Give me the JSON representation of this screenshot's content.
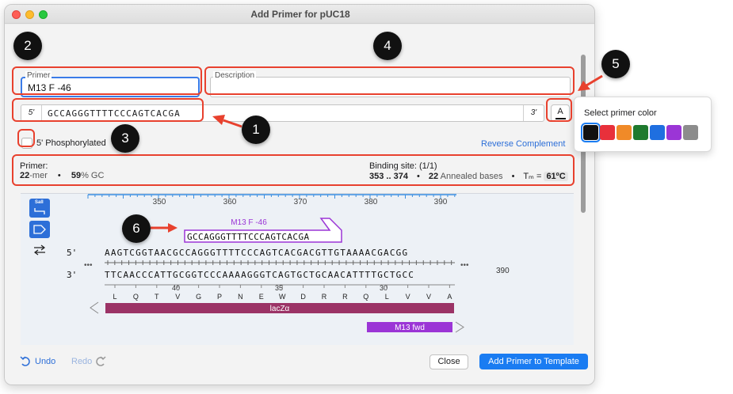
{
  "window": {
    "title": "Add Primer for pUC18"
  },
  "primer_name": {
    "legend": "Primer",
    "value": "M13 F -46"
  },
  "description": {
    "legend": "Description",
    "value": ""
  },
  "sequence_entry": {
    "prime5": "5'",
    "prime3": "3'",
    "value": "GCCAGGGTTTTCCCAGTCACGA"
  },
  "color_button": {
    "glyph": "A"
  },
  "phosphorylated": {
    "label": "5' Phosphorylated",
    "checked": false
  },
  "reverse_complement": {
    "label": "Reverse Complement"
  },
  "stats": {
    "primer_label": "Primer:",
    "length": "22",
    "length_unit": "-mer",
    "bullet": "•",
    "gc": "59",
    "gc_unit": "% GC",
    "binding_label": "Binding site: (1/1)",
    "range": "353 .. 374",
    "annealed": "22",
    "annealed_unit": "Annealed bases",
    "tm_label": "Tₘ =",
    "tm_value": "61ºC"
  },
  "color_popover": {
    "title": "Select primer color",
    "colors": [
      "#111111",
      "#e8303b",
      "#f08a28",
      "#1f7a2e",
      "#1f6fe0",
      "#9b35d6",
      "#8c8c8c"
    ],
    "selected_index": 0
  },
  "sequence_view": {
    "ruler": [
      "350",
      "360",
      "370",
      "380",
      "390"
    ],
    "primer_label": "M13 F -46",
    "primer_seq": "GCCAGGGTTTTCCCAGTCACGA",
    "top_prime": "5'",
    "top_seq": "AAGTCGGTAACGCCAGGGTTTTCCCAGTCACGACGTTGTAAAACGACGG",
    "bottom_prime": "3'",
    "bottom_seq": "TTCAACCCATTGCGGTCCCAAAAGGGTCAGTGCTGCAACATTTTGCTGCC",
    "ellipsis": "•••",
    "end_number": "390",
    "aa_numbers": [
      "40",
      "35",
      "30"
    ],
    "amino_acids": [
      "L",
      "Q",
      "T",
      "V",
      "G",
      "P",
      "N",
      "E",
      "W",
      "D",
      "R",
      "R",
      "Q",
      "L",
      "V",
      "V",
      "A"
    ],
    "feature_lacz": "lacZα",
    "feature_lacz_color": "#9b3366",
    "feature_m13": "M13 fwd",
    "feature_m13_color": "#9b35d6"
  },
  "tools": {
    "sall_label": "SalI"
  },
  "footer": {
    "undo": "Undo",
    "redo": "Redo",
    "close": "Close",
    "add": "Add Primer to Template"
  },
  "callouts": [
    "1",
    "2",
    "3",
    "4",
    "5",
    "6"
  ],
  "accent": "#e8412e"
}
